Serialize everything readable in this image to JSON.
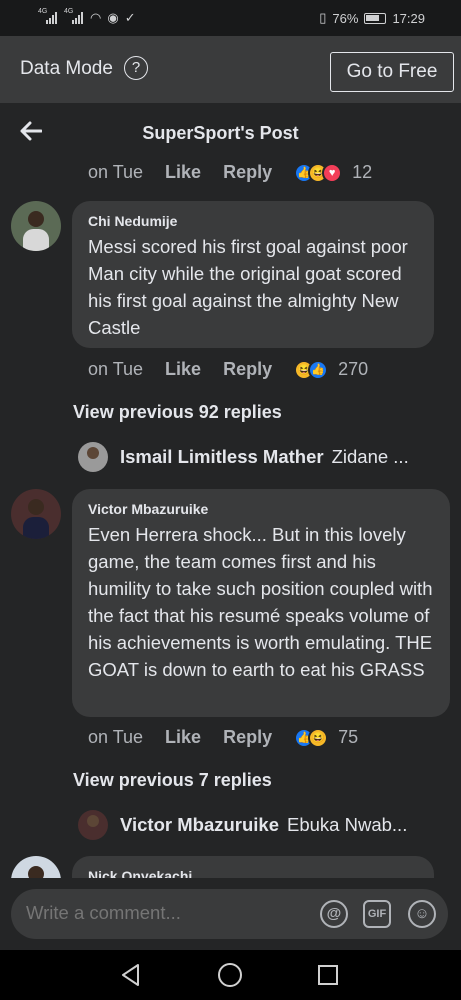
{
  "status_bar": {
    "network_left": "4G",
    "network_right": "4G",
    "battery": "76%",
    "time": "17:29"
  },
  "data_mode": {
    "label": "Data Mode",
    "info_icon": "?",
    "button": "Go to Free"
  },
  "header": {
    "back_icon": "arrow-left-icon",
    "title": "SuperSport's Post"
  },
  "top_meta": {
    "time": "on Tue",
    "like": "Like",
    "reply": "Reply",
    "reactions": [
      "like",
      "haha",
      "love"
    ],
    "count": "12"
  },
  "comments": [
    {
      "name": "Chi Nedumije",
      "text": "Messi scored his first goal against poor Man city while the original goat scored his first goal against the almighty New Castle",
      "time": "on Tue",
      "like": "Like",
      "reply": "Reply",
      "reactions": [
        "haha",
        "like"
      ],
      "count": "270",
      "view_previous": "View previous 92 replies",
      "latest_reply": {
        "name": "Ismail Limitless Mather",
        "text": "Zidane ..."
      }
    },
    {
      "name": "Victor Mbazuruike",
      "text": "Even Herrera shock... But in this lovely game, the team comes first and his humility to take such position coupled with the fact that his resumé speaks volume of his achievements is worth emulating. THE GOAT is down to earth to eat his GRASS",
      "time": "on Tue",
      "like": "Like",
      "reply": "Reply",
      "reactions": [
        "like",
        "haha"
      ],
      "count": "75",
      "view_previous": "View previous 7 replies",
      "latest_reply": {
        "name": "Victor Mbazuruike",
        "text": "Ebuka Nwab..."
      }
    },
    {
      "name": "Nick Onyekachi"
    }
  ],
  "composer": {
    "placeholder": "Write a comment...",
    "mention_icon": "@",
    "gif_icon": "GIF",
    "emoji_icon": "☺"
  },
  "colors": {
    "background": "#18191a",
    "surface": "#242526",
    "bubble": "#3a3b3c",
    "like_blue": "#1877f2"
  }
}
